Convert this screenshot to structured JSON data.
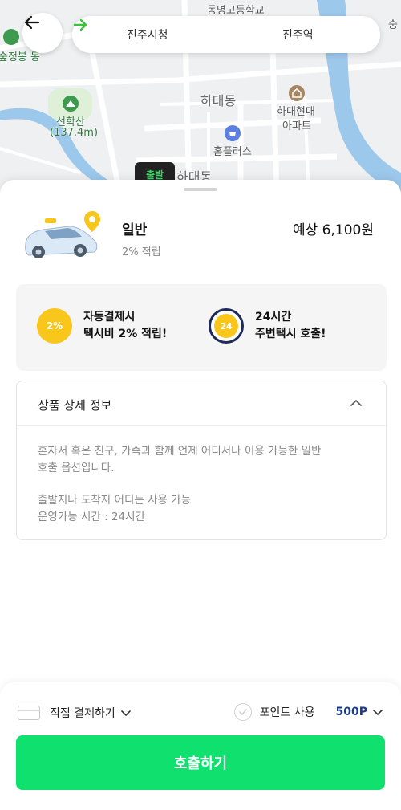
{
  "map": {
    "labels": {
      "school": "동명고등학교",
      "mountain_left": "숲정봉 동",
      "district": "하대동",
      "apartment_line1": "하대현대",
      "apartment_line2": "아파트",
      "mountain_name": "선학산",
      "mountain_height": "(137.4m)",
      "store": "홈플러스",
      "district_bottom": "하대동",
      "corner": "숭"
    },
    "start_chip": "출발"
  },
  "route": {
    "from": "진주시청",
    "to": "진주역"
  },
  "product": {
    "name": "일반",
    "subtitle": "2% 적립",
    "price": "예상 6,100원"
  },
  "promos": [
    {
      "badge": "2%",
      "line1": "자동결제시",
      "line2": "택시비 2% 적립!"
    },
    {
      "badge": "24",
      "line1": "24시간",
      "line2": "주변택시 호출!"
    }
  ],
  "detail": {
    "title": "상품 상세 정보",
    "desc_line1": "혼자서 혹은 친구, 가족과 함께 언제 어디서나 이용 가능한 일반",
    "desc_line2": "호출 옵션입니다.",
    "info_line1": "출발지나 도착지 어디든 사용 가능",
    "info_line2": "운영가능 시간 : 24시간"
  },
  "footer": {
    "payment_method": "직접 결제하기",
    "points_label": "포인트 사용",
    "points_value": "500P",
    "call_button": "호출하기"
  },
  "colors": {
    "accent_green": "#10e06e",
    "route_arrow": "#3dc13c",
    "promo_yellow": "#f9c61b",
    "points_blue": "#1e3a8a"
  }
}
